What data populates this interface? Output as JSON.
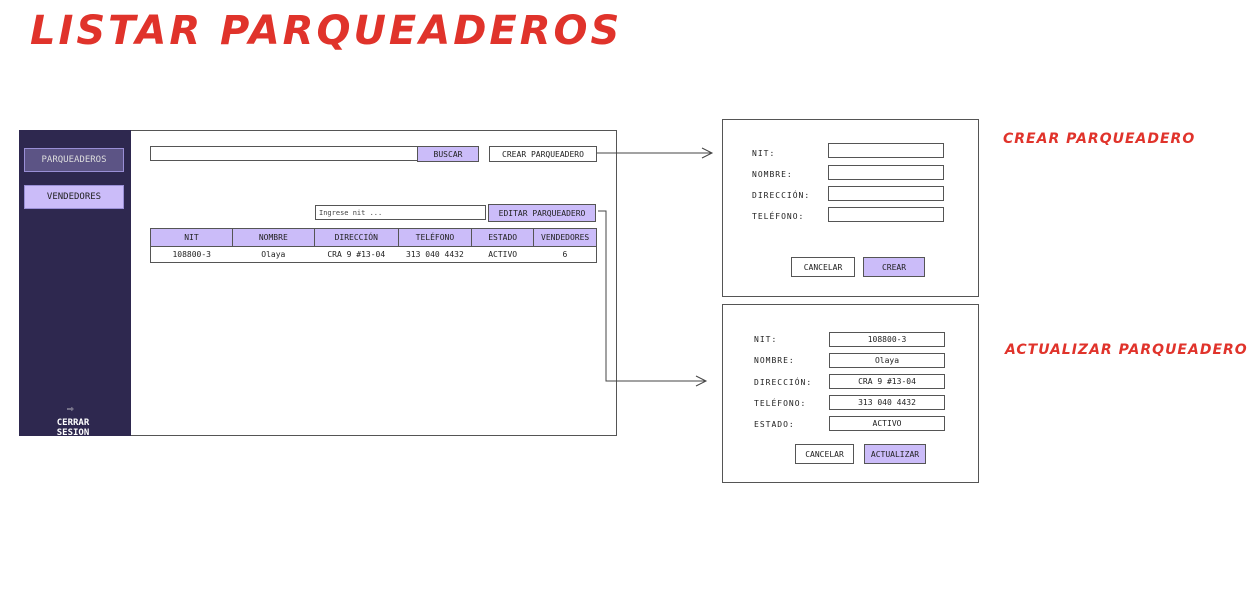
{
  "page": {
    "title": "LISTAR PARQUEADEROS"
  },
  "sidebar": {
    "items": [
      {
        "label": "PARQUEADEROS"
      },
      {
        "label": "VENDEDORES"
      }
    ],
    "logout_label": "CERRAR SESION",
    "logout_icon": "⇨"
  },
  "search": {
    "placeholder": "",
    "button_label": "BUSCAR"
  },
  "create_button_label": "CREAR PARQUEADERO",
  "edit": {
    "placeholder": "Ingrese nit ...",
    "button_label": "EDITAR PARQUEADERO"
  },
  "table": {
    "headers": [
      "NIT",
      "NOMBRE",
      "DIRECCIÓN",
      "TELÉFONO",
      "ESTADO",
      "VENDEDORES"
    ],
    "rows": [
      [
        "108800-3",
        "Olaya",
        "CRA 9 #13-04",
        "313 040 4432",
        "ACTIVO",
        "6"
      ]
    ]
  },
  "create_form": {
    "title": "CREAR PARQUEADERO",
    "fields": [
      {
        "label": "NIT:"
      },
      {
        "label": "NOMBRE:"
      },
      {
        "label": "DIRECCIÓN:"
      },
      {
        "label": "TELÉFONO:"
      }
    ],
    "cancel_label": "CANCELAR",
    "submit_label": "CREAR"
  },
  "update_form": {
    "title": "ACTUALIZAR PARQUEADERO",
    "fields": [
      {
        "label": "NIT:",
        "value": "108800-3"
      },
      {
        "label": "NOMBRE:",
        "value": "Olaya"
      },
      {
        "label": "DIRECCIÓN:",
        "value": "CRA 9 #13-04"
      },
      {
        "label": "TELÉFONO:",
        "value": "313 040 4432"
      },
      {
        "label": "ESTADO:",
        "value": "ACTIVO"
      }
    ],
    "cancel_label": "CANCELAR",
    "submit_label": "ACTUALIZAR"
  }
}
